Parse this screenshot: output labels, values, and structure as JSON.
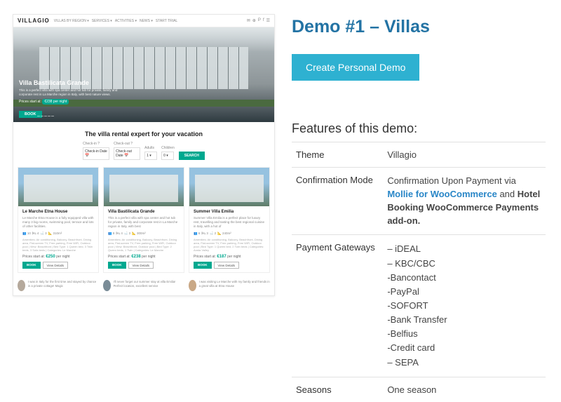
{
  "title": "Demo #1 – Villas",
  "create_button": "Create Personal Demo",
  "features_heading": "Features of this demo:",
  "rows": {
    "theme": {
      "label": "Theme",
      "value": "Villagio"
    },
    "confirmation": {
      "label": "Confirmation Mode",
      "prefix": "Confirmation Upon Payment via ",
      "link": "Mollie for WooCommerce",
      "suffix1": " and ",
      "bold": "Hotel Booking WooCommerce Payments add-on.",
      "suffix2": ""
    },
    "gateways": {
      "label": "Payment Gateways",
      "items": [
        "– iDEAL",
        "– KBC/CBC",
        "-Bancontact",
        "-PayPal",
        "-SOFORT",
        "-Bank Transfer",
        "-Belfius",
        "-Credit card",
        "– SEPA"
      ]
    },
    "seasons": {
      "label": "Seasons",
      "value": "One season"
    }
  },
  "preview": {
    "brand": "VILLAGIO",
    "nav": [
      "VILLAS BY REGION ▾",
      "SERVICES ▾",
      "ACTIVITIES ▾",
      "NEWS ▾",
      "START TRIAL"
    ],
    "social_icons": [
      "✉",
      "⊕",
      "P",
      "f",
      "☰"
    ],
    "hero": {
      "title": "Villa Bastilicata Grande",
      "sub": "This is a perfect villa with spa center and hot tub for private, family and corporate rest in La Marche region in Italy, with best nature views.",
      "price_prefix": "Prices start at: ",
      "price": "€238 per night",
      "book": "BOOK"
    },
    "tagline": "The villa rental expert for your vacation",
    "search": {
      "checkin": {
        "label": "Check-in ?",
        "value": "Check-in Date 📅"
      },
      "checkout": {
        "label": "Check-out ?",
        "value": "Check-out Date 📅"
      },
      "adults": {
        "label": "Adults",
        "value": "1 ▾"
      },
      "children": {
        "label": "Children",
        "value": "0 ▾"
      },
      "go": "SEARCH"
    },
    "cards": [
      {
        "title": "Le Marche Etna House",
        "desc": "Le Marche Etna House is a fully equipped villa with many 3 big rooms, swimming pool, terrace and lots of other facilities.",
        "meta": [
          "👥 10",
          "🛏 4",
          "🛁 3",
          "📐 310m²"
        ],
        "amen": "Amenities: Air conditioning, Balcony, Beachfront, Dining area, Flat-screen TV, Free parking, Free WiFi, Outdoor pool | View: Beachfront | Bed Type: 1 Queen bed, 3 Twin beds, 3 Sofa beds | Categories: Le Marche",
        "price_prefix": "Prices start at: ",
        "price": "€250",
        "per": " per night",
        "book": "BOOK",
        "details": "View Details"
      },
      {
        "title": "Villa Bastilicata Grande",
        "desc": "This is a perfect villa with spa center and hot tub for private, family and corporate rest in La Marche region in Italy, with best",
        "meta": [
          "👥 8",
          "🛏 4",
          "🛁 3",
          "📐 300m²"
        ],
        "amen": "Amenities: Air conditioning, Balcony, Beachfront, Dining area, Flat-screen TV, Free parking, Free WiFi, Outdoor pool | View: Beachfront, Outdoor pool | Bed Type: 2 Queen beds, 1 Twin | Categories: Le Marche",
        "price_prefix": "Prices start at: ",
        "price": "€238",
        "per": " per night",
        "book": "BOOK",
        "details": "View Details"
      },
      {
        "title": "Summer Villa Emilia",
        "desc": "Summer Villa Emilia is a perfect place for luxury rest, travelling and tasting the best regional cuisine in Italy, with a hot of",
        "meta": [
          "👥 6",
          "🛏 3",
          "🛁 2",
          "📐 240m²"
        ],
        "amen": "Amenities: Air conditioning, Balcony, Beachfront, Dining area, Flat-screen TV, Free parking, Free WiFi, Outdoor pool | Bed Type: 1 Queen bed, 2 Twin beds | Categories: Aosta Valley",
        "price_prefix": "Prices start at: ",
        "price": "€187",
        "per": " per night",
        "book": "BOOK",
        "details": "View Details"
      }
    ],
    "testimonials": [
      "I was in Italy for the first time and stayed by chance in a private cottage! Magic",
      "I'll never forget our summer stay at villa Emilia! Perfect location, excellent service",
      "I was visiting Le Marche with my family and friends in a great villa at Etna House"
    ]
  }
}
